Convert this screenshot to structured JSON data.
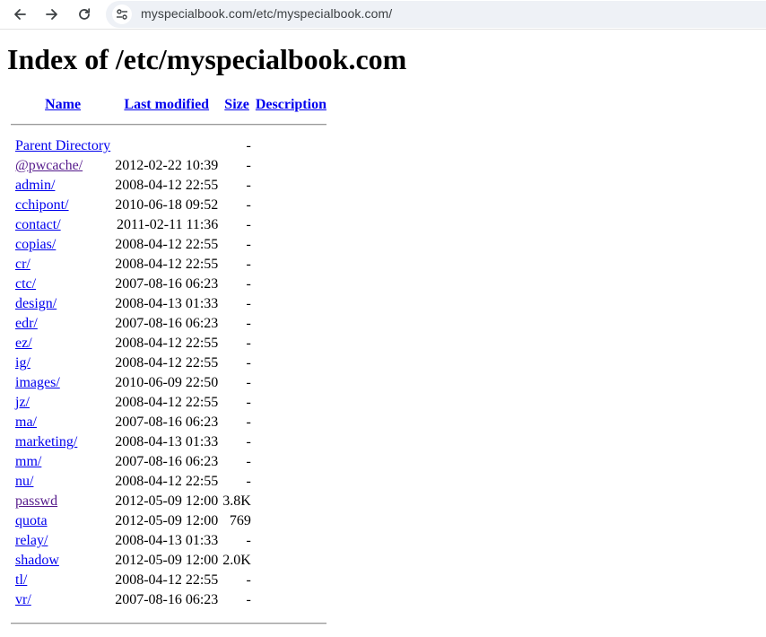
{
  "browser": {
    "url": "myspecialbook.com/etc/myspecialbook.com/",
    "back_icon": "arrow-left-icon",
    "forward_icon": "arrow-right-icon",
    "reload_icon": "reload-icon",
    "site_info_icon": "tune-icon"
  },
  "page": {
    "title": "Index of /etc/myspecialbook.com",
    "columns": {
      "name": "Name",
      "modified": "Last modified",
      "size": "Size",
      "description": "Description"
    },
    "rows": [
      {
        "name": "Parent Directory",
        "modified": "",
        "size": "-",
        "description": ""
      },
      {
        "name": "@pwcache/",
        "modified": "2012-02-22 10:39",
        "size": "-",
        "description": ""
      },
      {
        "name": "admin/",
        "modified": "2008-04-12 22:55",
        "size": "-",
        "description": ""
      },
      {
        "name": "cchipont/",
        "modified": "2010-06-18 09:52",
        "size": "-",
        "description": ""
      },
      {
        "name": "contact/",
        "modified": "2011-02-11 11:36",
        "size": "-",
        "description": ""
      },
      {
        "name": "copias/",
        "modified": "2008-04-12 22:55",
        "size": "-",
        "description": ""
      },
      {
        "name": "cr/",
        "modified": "2008-04-12 22:55",
        "size": "-",
        "description": ""
      },
      {
        "name": "ctc/",
        "modified": "2007-08-16 06:23",
        "size": "-",
        "description": ""
      },
      {
        "name": "design/",
        "modified": "2008-04-13 01:33",
        "size": "-",
        "description": ""
      },
      {
        "name": "edr/",
        "modified": "2007-08-16 06:23",
        "size": "-",
        "description": ""
      },
      {
        "name": "ez/",
        "modified": "2008-04-12 22:55",
        "size": "-",
        "description": ""
      },
      {
        "name": "ig/",
        "modified": "2008-04-12 22:55",
        "size": "-",
        "description": ""
      },
      {
        "name": "images/",
        "modified": "2010-06-09 22:50",
        "size": "-",
        "description": ""
      },
      {
        "name": "jz/",
        "modified": "2008-04-12 22:55",
        "size": "-",
        "description": ""
      },
      {
        "name": "ma/",
        "modified": "2007-08-16 06:23",
        "size": "-",
        "description": ""
      },
      {
        "name": "marketing/",
        "modified": "2008-04-13 01:33",
        "size": "-",
        "description": ""
      },
      {
        "name": "mm/",
        "modified": "2007-08-16 06:23",
        "size": "-",
        "description": ""
      },
      {
        "name": "nu/",
        "modified": "2008-04-12 22:55",
        "size": "-",
        "description": ""
      },
      {
        "name": "passwd",
        "modified": "2012-05-09 12:00",
        "size": "3.8K",
        "description": ""
      },
      {
        "name": "quota",
        "modified": "2012-05-09 12:00",
        "size": "769",
        "description": ""
      },
      {
        "name": "relay/",
        "modified": "2008-04-13 01:33",
        "size": "-",
        "description": ""
      },
      {
        "name": "shadow",
        "modified": "2012-05-09 12:00",
        "size": "2.0K",
        "description": ""
      },
      {
        "name": "tl/",
        "modified": "2008-04-12 22:55",
        "size": "-",
        "description": ""
      },
      {
        "name": "vr/",
        "modified": "2007-08-16 06:23",
        "size": "-",
        "description": ""
      }
    ],
    "visited": [
      "@pwcache/",
      "passwd"
    ],
    "colors": {
      "link": "#0000ee",
      "visited": "#551a8b"
    }
  }
}
